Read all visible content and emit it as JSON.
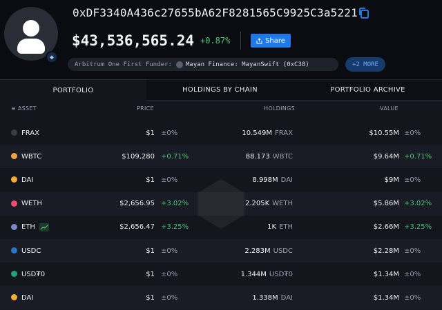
{
  "header": {
    "address": "0xDF3340A436c27655bA62F8281565C9925C3a5221",
    "balance": "$43,536,565.24",
    "change": "+0.87%",
    "share_label": "Share",
    "funder_prefix": "Arbitrum One First Funder:",
    "funder_entity": "Mayan Finance: MayanSwift (0xC38)",
    "more_label": "+2 MORE",
    "chain_badge_icon": "ethereum-icon"
  },
  "tabs": [
    {
      "label": "PORTFOLIO",
      "active": true
    },
    {
      "label": "HOLDINGS BY CHAIN",
      "active": false
    },
    {
      "label": "PORTFOLIO ARCHIVE",
      "active": false
    }
  ],
  "columns": {
    "asset": "ASSET",
    "price": "PRICE",
    "holdings": "HOLDINGS",
    "value": "VALUE"
  },
  "rows": [
    {
      "symbol": "FRAX",
      "price": "$1",
      "price_change": "±0%",
      "holdings": "10.549M",
      "unit": "FRAX",
      "value": "$10.55M",
      "value_change": "±0%",
      "icon": "frax-icon",
      "icon_color": "#3a3d44"
    },
    {
      "symbol": "WBTC",
      "price": "$109,280",
      "price_change": "+0.71%",
      "holdings": "88.173",
      "unit": "WBTC",
      "value": "$9.64M",
      "value_change": "+0.71%",
      "icon": "wbtc-icon",
      "icon_color": "#f2a14a"
    },
    {
      "symbol": "DAI",
      "price": "$1",
      "price_change": "±0%",
      "holdings": "8.998M",
      "unit": "DAI",
      "value": "$9M",
      "value_change": "±0%",
      "icon": "dai-icon",
      "icon_color": "#f5ac37"
    },
    {
      "symbol": "WETH",
      "price": "$2,656.95",
      "price_change": "+3.02%",
      "holdings": "2.205K",
      "unit": "WETH",
      "value": "$5.86M",
      "value_change": "+3.02%",
      "icon": "weth-icon",
      "icon_color": "#ec4d6e"
    },
    {
      "symbol": "ETH",
      "price": "$2,656.47",
      "price_change": "+3.25%",
      "holdings": "1K",
      "unit": "ETH",
      "value": "$2.66M",
      "value_change": "+3.25%",
      "icon": "eth-icon",
      "icon_color": "#7b86c8"
    },
    {
      "symbol": "USDC",
      "price": "$1",
      "price_change": "±0%",
      "holdings": "2.283M",
      "unit": "USDC",
      "value": "$2.28M",
      "value_change": "±0%",
      "icon": "usdc-icon",
      "icon_color": "#2775ca"
    },
    {
      "symbol": "USD₮0",
      "price": "$1",
      "price_change": "±0%",
      "holdings": "1.344M",
      "unit": "USD₮0",
      "value": "$1.34M",
      "value_change": "±0%",
      "icon": "usdt0-icon",
      "icon_color": "#26a17b"
    },
    {
      "symbol": "DAI",
      "price": "$1",
      "price_change": "±0%",
      "holdings": "1.338M",
      "unit": "DAI",
      "value": "$1.34M",
      "value_change": "±0%",
      "icon": "dai-icon",
      "icon_color": "#f5ac37"
    }
  ],
  "colors": {
    "positive": "#4cc77a",
    "accent": "#1e7ae8"
  }
}
